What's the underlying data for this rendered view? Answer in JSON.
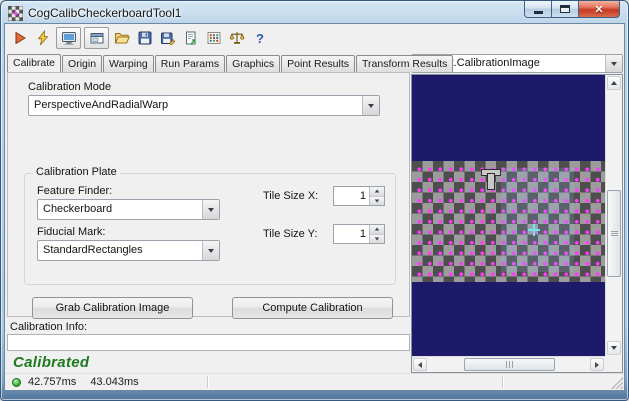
{
  "window": {
    "title": "CogCalibCheckerboardTool1"
  },
  "icons": {
    "help_glyph": "?",
    "close_glyph": "✕"
  },
  "toolbar": {
    "buttons": [
      "run",
      "electric",
      "image-display",
      "floating-image-display",
      "open",
      "save",
      "save-as",
      "export",
      "abacus",
      "balance",
      "help"
    ]
  },
  "tabs": {
    "active": "Calibrate",
    "items": [
      "Calibrate",
      "Origin",
      "Warping",
      "Run Params",
      "Graphics",
      "Point Results",
      "Transform Results"
    ]
  },
  "calibrate_page": {
    "calibration_mode_label": "Calibration Mode",
    "calibration_mode_value": "PerspectiveAndRadialWarp",
    "calibration_plate_label": "Calibration Plate",
    "feature_finder_label": "Feature Finder:",
    "feature_finder_value": "Checkerboard",
    "fiducial_mark_label": "Fiducial Mark:",
    "fiducial_mark_value": "StandardRectangles",
    "tile_size_x_label": "Tile Size X:",
    "tile_size_x_value": "1",
    "tile_size_y_label": "Tile Size Y:",
    "tile_size_y_value": "1",
    "grab_button_label": "Grab Calibration Image",
    "compute_button_label": "Compute Calibration"
  },
  "calibration_info": {
    "label": "Calibration Info:",
    "value": "",
    "status_text": "Calibrated"
  },
  "image_panel": {
    "selector_value": "Current.CalibrationImage"
  },
  "status_bar": {
    "time1": "42.757ms",
    "time2": "43.043ms"
  },
  "colors": {
    "image_background": "#1d196b",
    "marker_magenta": "#ff3aff",
    "status_green": "#1e7a1e",
    "led_green": "#3cb43c"
  }
}
